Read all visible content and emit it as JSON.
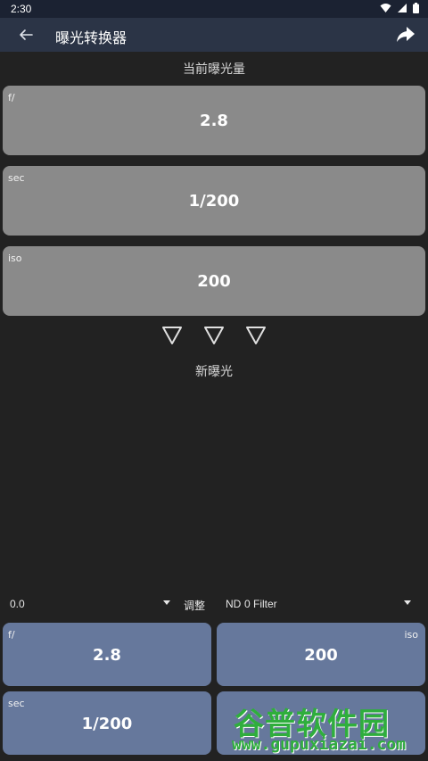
{
  "status_bar": {
    "time": "2:30"
  },
  "app_bar": {
    "title": "曝光转换器"
  },
  "current_exposure": {
    "heading": "当前曝光量",
    "aperture": {
      "label": "f/",
      "value": "2.8"
    },
    "shutter": {
      "label": "sec",
      "value": "1/200"
    },
    "iso": {
      "label": "iso",
      "value": "200"
    }
  },
  "new_exposure": {
    "heading": "新曝光",
    "adjust_value": "0.0",
    "adjust_label": "调整",
    "nd_label": "ND",
    "nd_value": "0 Filter",
    "aperture": {
      "label": "f/",
      "value": "2.8"
    },
    "iso": {
      "label": "iso",
      "value": "200"
    },
    "shutter": {
      "label": "sec",
      "value": "1/200"
    }
  },
  "watermark": {
    "line1": "谷普软件园",
    "line2": "www.gupuxiazai.com"
  },
  "colors": {
    "appbar": "#2b3446",
    "background": "#222222",
    "card_gray": "#8a8a8a",
    "card_blue": "#66789c"
  }
}
